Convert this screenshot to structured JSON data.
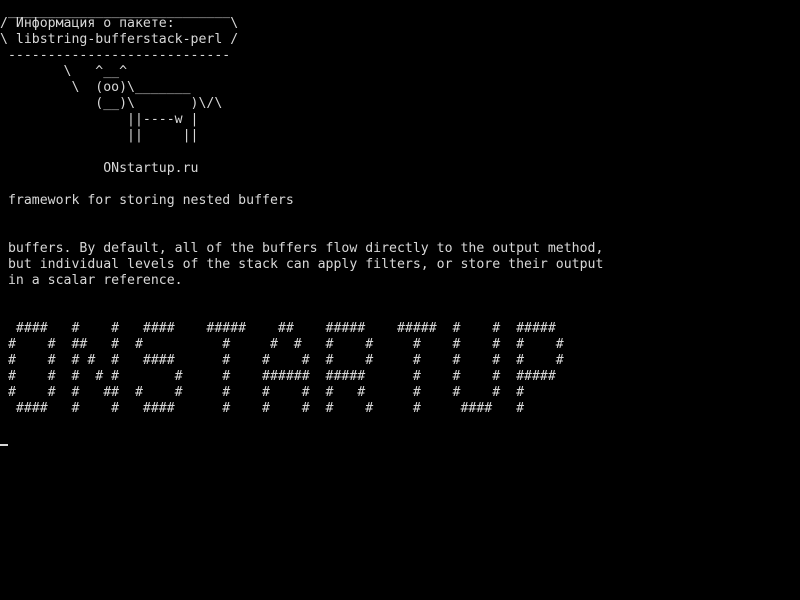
{
  "terminal": {
    "bubble": {
      "top_border": " ____________________________",
      "line1": "/ Информация о пакете:       \\",
      "line2": "\\ libstring-bufferstack-perl /",
      "bottom_border": " ----------------------------"
    },
    "cow": [
      "        \\   ^__^",
      "         \\  (oo)\\_______",
      "            (__)\\       )\\/\\",
      "                ||----w |",
      "                ||     ||"
    ],
    "site": "             ONstartup.ru",
    "summary": " framework for storing nested buffers",
    "description": [
      " buffers. By default, all of the buffers flow directly to the output method,",
      " but individual levels of the stack can apply filters, or store their output",
      " in a scalar reference."
    ],
    "banner": [
      "  ####   #    #   ####    #####    ##    #####    #####  #    #  #####",
      " #    #  ##   #  #          #     #  #   #    #     #    #    #  #    #",
      " #    #  # #  #   ####      #    #    #  #    #     #    #    #  #    #",
      " #    #  #  # #       #     #    ######  #####      #    #    #  #####",
      " #    #  #   ##  #    #     #    #    #  #   #      #    #    #  #",
      "  ####   #    #   ####      #    #    #  #    #     #     ####   #"
    ]
  }
}
